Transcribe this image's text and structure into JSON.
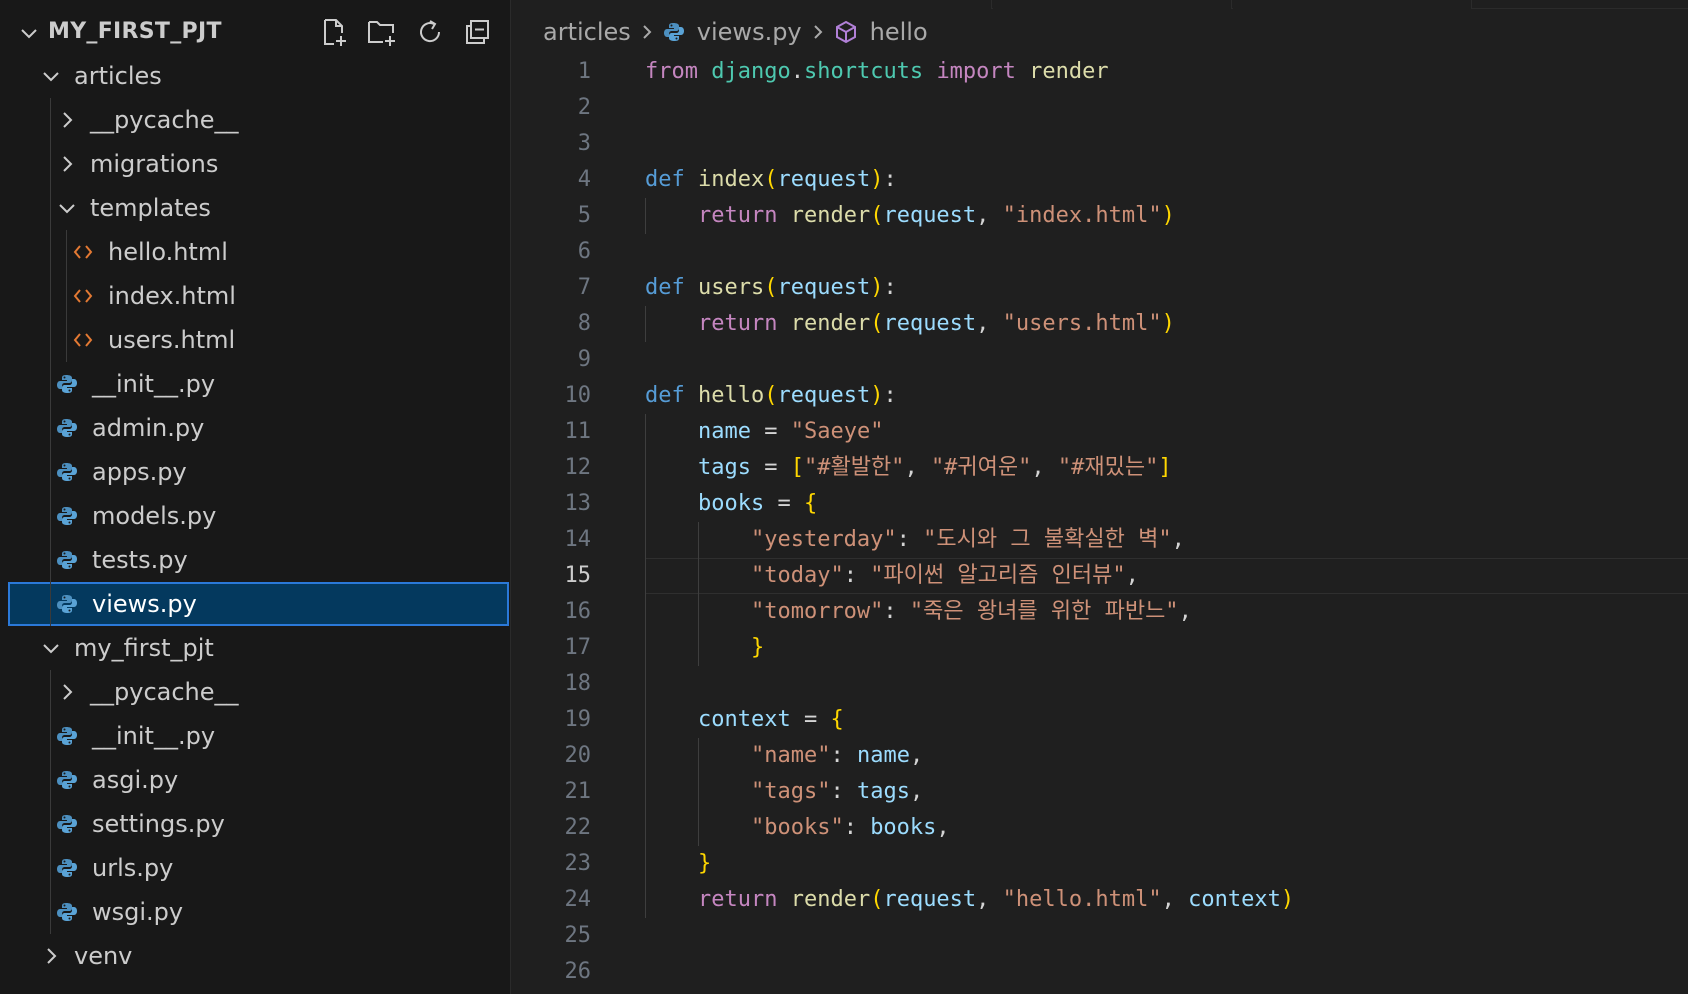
{
  "explorer": {
    "title": "MY_FIRST_PJT",
    "actions": [
      "new-file-icon",
      "new-folder-icon",
      "refresh-icon",
      "collapse-all-icon"
    ],
    "items": [
      {
        "label": "articles",
        "type": "folder",
        "expanded": true,
        "depth": 1
      },
      {
        "label": "__pycache__",
        "type": "folder",
        "expanded": false,
        "depth": 2
      },
      {
        "label": "migrations",
        "type": "folder",
        "expanded": false,
        "depth": 2
      },
      {
        "label": "templates",
        "type": "folder",
        "expanded": true,
        "depth": 2
      },
      {
        "label": "hello.html",
        "type": "html",
        "depth": 3
      },
      {
        "label": "index.html",
        "type": "html",
        "depth": 3
      },
      {
        "label": "users.html",
        "type": "html",
        "depth": 3
      },
      {
        "label": "__init__.py",
        "type": "py",
        "depth": 2
      },
      {
        "label": "admin.py",
        "type": "py",
        "depth": 2
      },
      {
        "label": "apps.py",
        "type": "py",
        "depth": 2
      },
      {
        "label": "models.py",
        "type": "py",
        "depth": 2
      },
      {
        "label": "tests.py",
        "type": "py",
        "depth": 2
      },
      {
        "label": "views.py",
        "type": "py",
        "depth": 2,
        "selected": true
      },
      {
        "label": "my_first_pjt",
        "type": "folder",
        "expanded": true,
        "depth": 1
      },
      {
        "label": "__pycache__",
        "type": "folder",
        "expanded": false,
        "depth": 2
      },
      {
        "label": "__init__.py",
        "type": "py",
        "depth": 2
      },
      {
        "label": "asgi.py",
        "type": "py",
        "depth": 2
      },
      {
        "label": "settings.py",
        "type": "py",
        "depth": 2
      },
      {
        "label": "urls.py",
        "type": "py",
        "depth": 2
      },
      {
        "label": "wsgi.py",
        "type": "py",
        "depth": 2
      },
      {
        "label": "venv",
        "type": "folder",
        "expanded": false,
        "depth": 1
      }
    ]
  },
  "breadcrumb": {
    "folder": "articles",
    "file": "views.py",
    "symbol": "hello"
  },
  "editor": {
    "active_line": 15,
    "lines": [
      [
        [
          "kw",
          "from"
        ],
        [
          "pl",
          " "
        ],
        [
          "mod",
          "django"
        ],
        [
          "pl",
          "."
        ],
        [
          "mod",
          "shortcuts"
        ],
        [
          "pl",
          " "
        ],
        [
          "kw",
          "import"
        ],
        [
          "pl",
          " "
        ],
        [
          "fn",
          "render"
        ]
      ],
      [],
      [],
      [
        [
          "def",
          "def"
        ],
        [
          "pl",
          " "
        ],
        [
          "fn",
          "index"
        ],
        [
          "br1",
          "("
        ],
        [
          "var",
          "request"
        ],
        [
          "br1",
          ")"
        ],
        [
          "pl",
          ":"
        ]
      ],
      [
        [
          "pl",
          "    "
        ],
        [
          "kw",
          "return"
        ],
        [
          "pl",
          " "
        ],
        [
          "fn",
          "render"
        ],
        [
          "br1",
          "("
        ],
        [
          "var",
          "request"
        ],
        [
          "pl",
          ", "
        ],
        [
          "str",
          "\"index.html\""
        ],
        [
          "br1",
          ")"
        ]
      ],
      [],
      [
        [
          "def",
          "def"
        ],
        [
          "pl",
          " "
        ],
        [
          "fn",
          "users"
        ],
        [
          "br1",
          "("
        ],
        [
          "var",
          "request"
        ],
        [
          "br1",
          ")"
        ],
        [
          "pl",
          ":"
        ]
      ],
      [
        [
          "pl",
          "    "
        ],
        [
          "kw",
          "return"
        ],
        [
          "pl",
          " "
        ],
        [
          "fn",
          "render"
        ],
        [
          "br1",
          "("
        ],
        [
          "var",
          "request"
        ],
        [
          "pl",
          ", "
        ],
        [
          "str",
          "\"users.html\""
        ],
        [
          "br1",
          ")"
        ]
      ],
      [],
      [
        [
          "def",
          "def"
        ],
        [
          "pl",
          " "
        ],
        [
          "fn",
          "hello"
        ],
        [
          "br1",
          "("
        ],
        [
          "var",
          "request"
        ],
        [
          "br1",
          ")"
        ],
        [
          "pl",
          ":"
        ]
      ],
      [
        [
          "pl",
          "    "
        ],
        [
          "var",
          "name"
        ],
        [
          "pl",
          " = "
        ],
        [
          "str",
          "\"Saeye\""
        ]
      ],
      [
        [
          "pl",
          "    "
        ],
        [
          "var",
          "tags"
        ],
        [
          "pl",
          " = "
        ],
        [
          "br1",
          "["
        ],
        [
          "str",
          "\"#활발한\""
        ],
        [
          "pl",
          ", "
        ],
        [
          "str",
          "\"#귀여운\""
        ],
        [
          "pl",
          ", "
        ],
        [
          "str",
          "\"#재밌는\""
        ],
        [
          "br1",
          "]"
        ]
      ],
      [
        [
          "pl",
          "    "
        ],
        [
          "var",
          "books"
        ],
        [
          "pl",
          " = "
        ],
        [
          "br1",
          "{"
        ]
      ],
      [
        [
          "pl",
          "        "
        ],
        [
          "str",
          "\"yesterday\""
        ],
        [
          "pl",
          ": "
        ],
        [
          "str",
          "\"도시와 그 불확실한 벽\""
        ],
        [
          "pl",
          ","
        ]
      ],
      [
        [
          "pl",
          "        "
        ],
        [
          "str",
          "\"today\""
        ],
        [
          "pl",
          ": "
        ],
        [
          "str",
          "\"파이썬 알고리즘 인터뷰\""
        ],
        [
          "pl",
          ","
        ]
      ],
      [
        [
          "pl",
          "        "
        ],
        [
          "str",
          "\"tomorrow\""
        ],
        [
          "pl",
          ": "
        ],
        [
          "str",
          "\"죽은 왕녀를 위한 파반느\""
        ],
        [
          "pl",
          ","
        ]
      ],
      [
        [
          "pl",
          "        "
        ],
        [
          "br1",
          "}"
        ]
      ],
      [],
      [
        [
          "pl",
          "    "
        ],
        [
          "var",
          "context"
        ],
        [
          "pl",
          " = "
        ],
        [
          "br1",
          "{"
        ]
      ],
      [
        [
          "pl",
          "        "
        ],
        [
          "str",
          "\"name\""
        ],
        [
          "pl",
          ": "
        ],
        [
          "var",
          "name"
        ],
        [
          "pl",
          ","
        ]
      ],
      [
        [
          "pl",
          "        "
        ],
        [
          "str",
          "\"tags\""
        ],
        [
          "pl",
          ": "
        ],
        [
          "var",
          "tags"
        ],
        [
          "pl",
          ","
        ]
      ],
      [
        [
          "pl",
          "        "
        ],
        [
          "str",
          "\"books\""
        ],
        [
          "pl",
          ": "
        ],
        [
          "var",
          "books"
        ],
        [
          "pl",
          ","
        ]
      ],
      [
        [
          "pl",
          "    "
        ],
        [
          "br1",
          "}"
        ]
      ],
      [
        [
          "pl",
          "    "
        ],
        [
          "kw",
          "return"
        ],
        [
          "pl",
          " "
        ],
        [
          "fn",
          "render"
        ],
        [
          "br1",
          "("
        ],
        [
          "var",
          "request"
        ],
        [
          "pl",
          ", "
        ],
        [
          "str",
          "\"hello.html\""
        ],
        [
          "pl",
          ", "
        ],
        [
          "var",
          "context"
        ],
        [
          "br1",
          ")"
        ]
      ],
      [],
      []
    ]
  }
}
